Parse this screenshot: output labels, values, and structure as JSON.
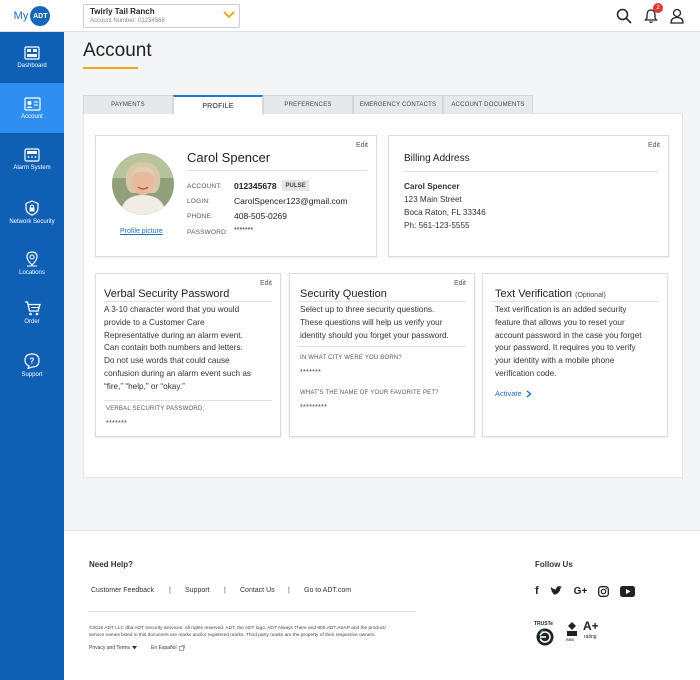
{
  "brand": {
    "my": "My",
    "logo": "ADT"
  },
  "site_selector": {
    "name": "Twirly Tail Ranch",
    "account": "Account Number: 01234568"
  },
  "header": {
    "notification_count": "2"
  },
  "sidebar": {
    "items": [
      {
        "label": "Dashboard",
        "icon": "dashboard-icon"
      },
      {
        "label": "Account",
        "icon": "account-icon"
      },
      {
        "label": "Alarm System",
        "icon": "alarm-panel-icon"
      },
      {
        "label": "Network Security",
        "icon": "shield-lock-icon"
      },
      {
        "label": "Locations",
        "icon": "location-pin-icon"
      },
      {
        "label": "Order",
        "icon": "cart-icon"
      },
      {
        "label": "Support",
        "icon": "help-icon"
      }
    ]
  },
  "page": {
    "title": "Account"
  },
  "tabs": [
    "PAYMENTS",
    "PROFILE",
    "PREFERENCES",
    "EMERGENCY CONTACTS",
    "ACCOUNT DOCUMENTS"
  ],
  "profile": {
    "edit": "Edit",
    "name": "Carol Spencer",
    "account_label": "ACCOUNT:",
    "account_value": "012345678",
    "badge": "PULSE",
    "login_label": "LOGIN:",
    "login_value": "CarolSpencer123@gmail.com",
    "phone_label": "PHONE:",
    "phone_value": "408-505-0269",
    "password_label": "PASSWORD:",
    "password_value": "*******",
    "picture_link": "Profile picture"
  },
  "billing": {
    "edit": "Edit",
    "title": "Billing Address",
    "name": "Carol Spencer",
    "street": "123 Main Street",
    "city": "Boca Raton, FL 33346",
    "phone": "Ph: 561-123-5555"
  },
  "verbal": {
    "edit": "Edit",
    "title": "Verbal Security Password",
    "lines": [
      "A 3-10 character word that you would",
      "provide to a Customer Care",
      "Representative during an alarm event.",
      "Can contain both numbers and letters.",
      "Do not use words that could cause",
      "confusion during an alarm event such as",
      "“fire,” “help,” or “okay.”"
    ],
    "field_label": "VERBAL SECURITY PASSWORD:",
    "field_value": "*******"
  },
  "security": {
    "edit": "Edit",
    "title": "Security Question",
    "lines": [
      "Select up to three security questions.",
      "These questions will help us verify your",
      "identity should you forget your password."
    ],
    "q1": "IN WHAT CITY WERE YOU BORN?",
    "a1": "*******",
    "q2": "WHAT'S THE NAME OF YOUR FAVORITE PET?",
    "a2": "*********"
  },
  "text_verification": {
    "title": "Text Verification",
    "optional": "(Optional)",
    "lines": [
      "Text verification is an added security",
      "feature that allows you to reset your",
      "account password in the case you forget",
      "your password. It requires you to verify",
      "your identity with a mobile phone",
      "verification code."
    ],
    "activate": "Activate"
  },
  "footer": {
    "need_help": "Need Help?",
    "links": [
      "Customer Feedback",
      "Support",
      "Contact Us",
      "Go to ADT.com"
    ],
    "separator": "|",
    "legal_line1": "©2018 ADT LLC dba ADT Security Services. All rights reserved. ADT, the ADT logo, ADT Always There and 800.ADT.ASAP and the product/",
    "legal_line2": "service names listed in this document are marks and/or registered marks. Third party marks are the property of their respective owners.",
    "privacy": "Privacy and Terms",
    "espanol": "En Español",
    "follow_us": "Follow Us",
    "truste": "TRUSTe",
    "bbb": "BBB",
    "rating": "A+",
    "rating_label": "rating"
  }
}
